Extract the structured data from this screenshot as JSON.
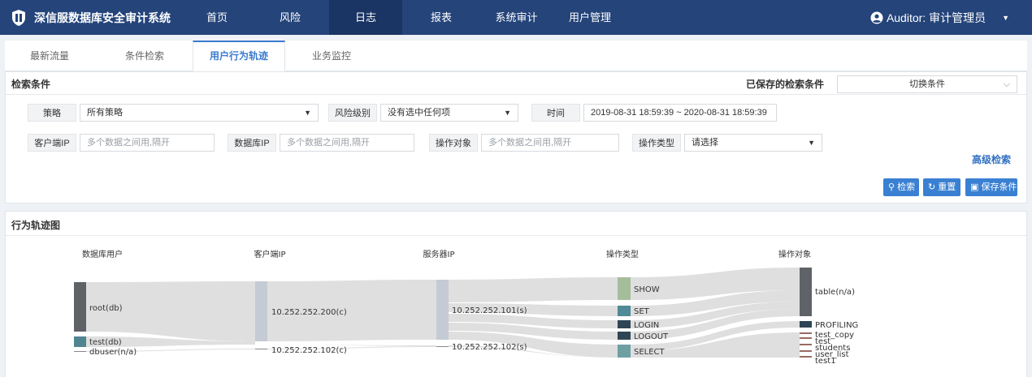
{
  "app": {
    "title": "深信服数据库安全审计系统",
    "user_label": "Auditor: 审计管理员"
  },
  "nav": [
    {
      "label": "首页"
    },
    {
      "label": "风险"
    },
    {
      "label": "日志"
    },
    {
      "label": "报表"
    },
    {
      "label": "系统审计"
    },
    {
      "label": "用户管理"
    }
  ],
  "nav_active": "日志",
  "tabs": [
    {
      "label": "最新流量"
    },
    {
      "label": "条件检索"
    },
    {
      "label": "用户行为轨迹"
    },
    {
      "label": "业务监控"
    }
  ],
  "tabs_active": "用户行为轨迹",
  "search": {
    "title": "检索条件",
    "saved_label": "已保存的检索条件",
    "saved_select": "切换条件",
    "policy_label": "策略",
    "policy_value": "所有策略",
    "risk_label": "风险级别",
    "risk_value": "没有选中任何项",
    "time_label": "时间",
    "time_value": "2019-08-31 18:59:39 ~ 2020-08-31 18:59:39",
    "client_ip_label": "客户端IP",
    "client_ip_placeholder": "多个数据之间用,隔开",
    "db_ip_label": "数据库IP",
    "db_ip_placeholder": "多个数据之间用,隔开",
    "op_object_label": "操作对象",
    "op_object_placeholder": "多个数据之间用,隔开",
    "op_type_label": "操作类型",
    "op_type_value": "请选择",
    "advanced": "高级检索",
    "btn_search": "检索",
    "btn_reset": "重置",
    "btn_save": "保存条件"
  },
  "graph": {
    "title": "行为轨迹图",
    "columns": [
      "数据库用户",
      "客户端IP",
      "服务器IP",
      "操作类型",
      "操作对象"
    ],
    "nodes": {
      "db_users": [
        "root(db)",
        "test(db)",
        "dbuser(n/a)"
      ],
      "client_ips": [
        "10.252.252.200(c)",
        "10.252.252.102(c)"
      ],
      "server_ips": [
        "10.252.252.101(s)",
        "10.252.252.102(s)"
      ],
      "op_types": [
        "SHOW",
        "SET",
        "LOGIN",
        "LOGOUT",
        "SELECT"
      ],
      "op_objects": [
        "table(n/a)",
        "PROFILING",
        "test_copy",
        "test",
        "students",
        "user_list",
        "test1"
      ]
    },
    "colors": {
      "root": "#5f6368",
      "test": "#4e8591",
      "ip": "#c4cbd4",
      "show": "#a6bd9c",
      "set": "#4f8a96",
      "dark": "#2f4554",
      "select": "#6ea0a3",
      "small": "#9a6b62",
      "link": "#dcdcdc"
    }
  }
}
